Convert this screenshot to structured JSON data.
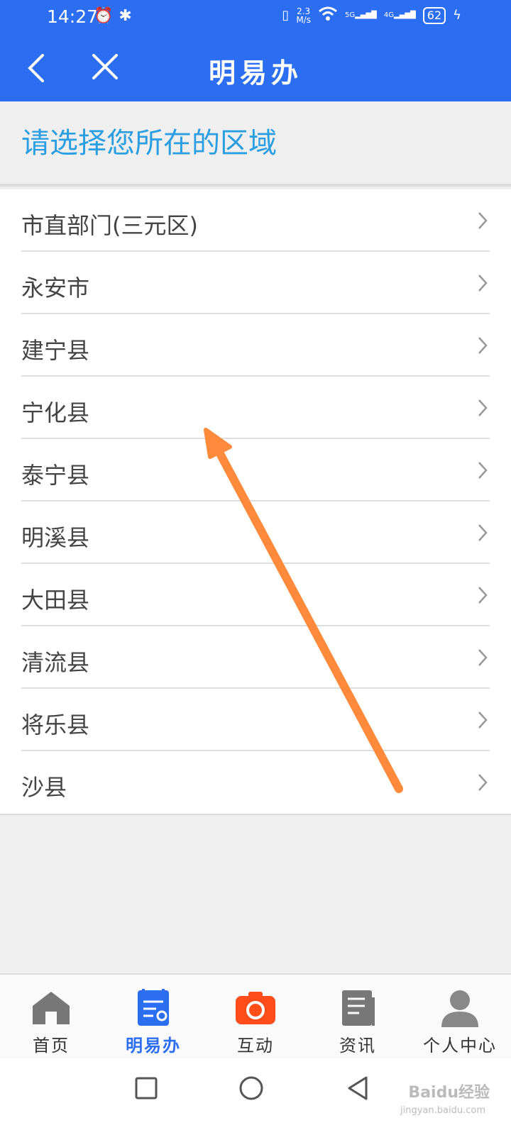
{
  "status": {
    "time": "14:27",
    "speed_top": "2.3",
    "speed_bottom": "M/s",
    "net1": "5G",
    "net2": "4G",
    "battery": "62"
  },
  "nav": {
    "title": "明易办"
  },
  "prompt": {
    "text": "请选择您所在的区域"
  },
  "regions": [
    {
      "label": "市直部门(三元区)"
    },
    {
      "label": "永安市"
    },
    {
      "label": "建宁县"
    },
    {
      "label": "宁化县"
    },
    {
      "label": "泰宁县"
    },
    {
      "label": "明溪县"
    },
    {
      "label": "大田县"
    },
    {
      "label": "清流县"
    },
    {
      "label": "将乐县"
    },
    {
      "label": "沙县"
    }
  ],
  "tabs": [
    {
      "label": "首页",
      "icon": "home-icon"
    },
    {
      "label": "明易办",
      "icon": "document-icon",
      "active": true
    },
    {
      "label": "互动",
      "icon": "camera-icon"
    },
    {
      "label": "资讯",
      "icon": "news-icon"
    },
    {
      "label": "个人中心",
      "icon": "user-icon"
    }
  ],
  "watermark": {
    "main": "Baidu经验",
    "sub": "jingyan.baidu.com"
  },
  "colors": {
    "brand": "#2b6ef2",
    "prompt": "#2a9ee0",
    "arrow": "#ff8a3c",
    "camera": "#ff4d1a"
  }
}
